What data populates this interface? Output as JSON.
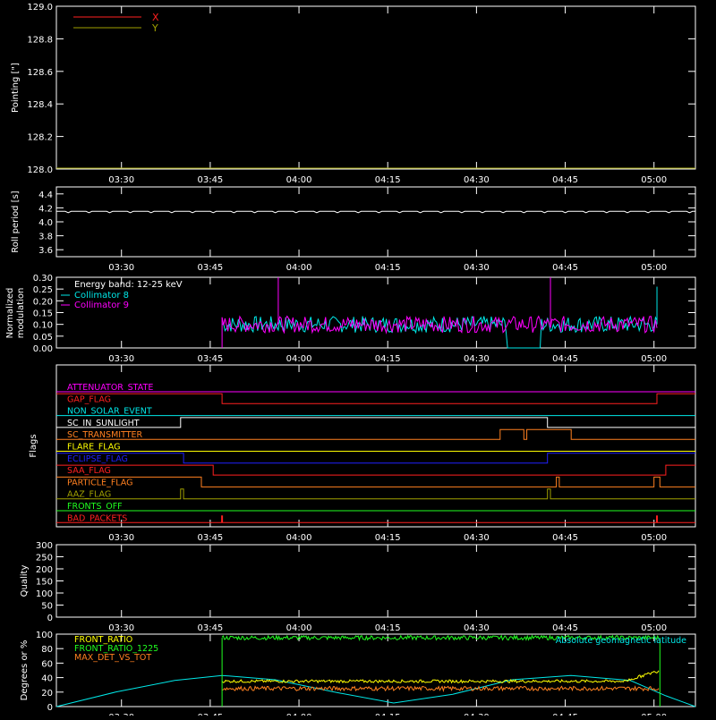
{
  "colors": {
    "bg": "#000000",
    "axis": "#ffffff",
    "red": "#ff2020",
    "yellow": "#ffff00",
    "olive": "#a0a000",
    "cyan": "#00e8e8",
    "magenta": "#ff00ff",
    "blue": "#2020ff",
    "orange": "#ff8020",
    "green": "#20ff20",
    "salmon": "#ff6040"
  },
  "x_ticks": [
    "03:30",
    "03:45",
    "04:00",
    "04:15",
    "04:30",
    "04:45",
    "05:00"
  ],
  "chart_data": [
    {
      "id": "pointing",
      "type": "line",
      "ylabel": "Pointing [\"]",
      "ylim": [
        128.0,
        129.0
      ],
      "yticks": [
        "128.0",
        "128.2",
        "128.4",
        "128.6",
        "128.8",
        "129.0"
      ],
      "xlim_minutes_after_0300": [
        19,
        127
      ],
      "legend": "top-left",
      "series": [
        {
          "name": "X",
          "color": "#ff2020",
          "x": [],
          "y": []
        },
        {
          "name": "Y",
          "color": "#a0a000",
          "x": [],
          "y": []
        }
      ]
    },
    {
      "id": "roll",
      "type": "line",
      "ylabel": "Roll period [s]",
      "ylim": [
        3.5,
        4.5
      ],
      "yticks": [
        "3.6",
        "3.8",
        "4.0",
        "4.2",
        "4.4"
      ],
      "series": [
        {
          "color": "#ffffff",
          "x_minutes_after_0300": [
            19,
            127
          ],
          "y": [
            4.15,
            4.15
          ]
        }
      ]
    },
    {
      "id": "modulation",
      "type": "line",
      "ylabel": "Normalized modulation",
      "ylim": [
        0.0,
        0.3
      ],
      "yticks": [
        "0.00",
        "0.05",
        "0.10",
        "0.15",
        "0.20",
        "0.25",
        "0.30"
      ],
      "annotation": "Energy band: 12-25 keV",
      "series": [
        {
          "name": "Collimator 8",
          "color": "#00e8e8",
          "start": "03:47",
          "end": "05:00",
          "level": 0.1
        },
        {
          "name": "Collimator 9",
          "color": "#ff00ff",
          "start": "03:47",
          "end": "05:00",
          "level": 0.1
        }
      ]
    },
    {
      "id": "flags",
      "type": "line",
      "ylabel": "Flags",
      "flags": [
        {
          "name": "ATTENUATOR_STATE",
          "color": "#ff00ff",
          "segments": [
            [
              19,
              127,
              0
            ]
          ]
        },
        {
          "name": "GAP_FLAG",
          "color": "#ff2020",
          "segments": [
            [
              19,
              47,
              1
            ],
            [
              47,
              120.5,
              0
            ],
            [
              120.5,
              127,
              1
            ]
          ]
        },
        {
          "name": "NON_SOLAR_EVENT",
          "color": "#00e8e8",
          "segments": [
            [
              19,
              127,
              0
            ]
          ]
        },
        {
          "name": "SC_IN_SUNLIGHT",
          "color": "#ffffff",
          "segments": [
            [
              19,
              40,
              0
            ],
            [
              40,
              102,
              1
            ],
            [
              102,
              127,
              0
            ]
          ]
        },
        {
          "name": "SC_TRANSMITTER",
          "color": "#ff8020",
          "segments": [
            [
              19,
              94,
              0
            ],
            [
              94,
              98,
              1
            ],
            [
              98,
              98.5,
              0
            ],
            [
              98.5,
              106,
              1
            ],
            [
              106,
              127,
              0
            ]
          ]
        },
        {
          "name": "FLARE_FLAG",
          "color": "#ffff00",
          "segments": [
            [
              19,
              127,
              0
            ]
          ]
        },
        {
          "name": "ECLIPSE_FLAG",
          "color": "#2020ff",
          "segments": [
            [
              19,
              40.5,
              1
            ],
            [
              40.5,
              102,
              0
            ],
            [
              102,
              127,
              1
            ]
          ]
        },
        {
          "name": "SAA_FLAG",
          "color": "#ff2020",
          "segments": [
            [
              19,
              45.5,
              1
            ],
            [
              45.5,
              122,
              0
            ],
            [
              122,
              127,
              1
            ]
          ]
        },
        {
          "name": "PARTICLE_FLAG",
          "color": "#ff8020",
          "segments": [
            [
              19,
              43.5,
              1
            ],
            [
              43.5,
              103.5,
              0
            ],
            [
              103.5,
              104,
              1
            ],
            [
              104,
              120,
              0
            ],
            [
              120,
              121,
              1
            ],
            [
              121,
              127,
              0
            ]
          ]
        },
        {
          "name": "AAZ_FLAG",
          "color": "#a0a000",
          "segments": [
            [
              19,
              40,
              0
            ],
            [
              40,
              40.5,
              1
            ],
            [
              40.5,
              102,
              0
            ],
            [
              102,
              102.5,
              1
            ],
            [
              102.5,
              127,
              0
            ]
          ]
        },
        {
          "name": "FRONTS_OFF",
          "color": "#20ff20",
          "segments": [
            [
              19,
              127,
              0
            ]
          ]
        },
        {
          "name": "BAD_PACKETS",
          "color": "#ff2020",
          "spikes": [
            47,
            120.5
          ]
        }
      ]
    },
    {
      "id": "quality",
      "type": "line",
      "ylabel": "Quality",
      "ylim": [
        0,
        300
      ],
      "yticks": [
        "0",
        "50",
        "100",
        "150",
        "200",
        "250",
        "300"
      ],
      "series": []
    },
    {
      "id": "front_ratio",
      "type": "line",
      "ylabel": "Degrees or %",
      "ylim": [
        0,
        100
      ],
      "yticks": [
        "0",
        "20",
        "40",
        "60",
        "80",
        "100"
      ],
      "annotation": "Absolute geomagnetic latitude",
      "series": [
        {
          "name": "FRONT_RATIO",
          "color": "#ffff00",
          "start": 47,
          "end": 121,
          "level": 35
        },
        {
          "name": "FRONT_RATIO_1225",
          "color": "#20ff20",
          "start": 47,
          "end": 121,
          "level": 95
        },
        {
          "name": "MAX_DET_VS_TOT",
          "color": "#ff8020",
          "start": 47,
          "end": 121,
          "level": 25
        },
        {
          "name": "Absolute geomagnetic latitude",
          "color": "#00e8e8",
          "x": [
            19,
            29,
            39,
            47,
            56,
            66,
            76,
            86,
            96,
            106,
            116,
            122,
            127
          ],
          "y": [
            0,
            20,
            36,
            43,
            37,
            20,
            5,
            17,
            37,
            43,
            36,
            15,
            0
          ]
        }
      ]
    }
  ]
}
